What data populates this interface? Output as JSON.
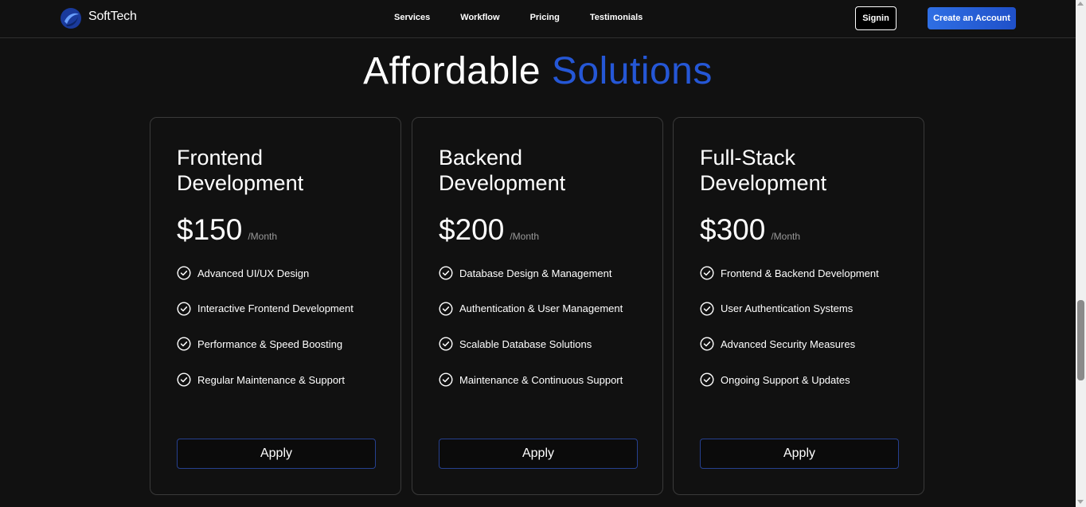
{
  "brand": {
    "name": "SoftTech",
    "accent_color": "#2557d6"
  },
  "nav": {
    "links": [
      "Services",
      "Workflow",
      "Pricing",
      "Testimonials"
    ],
    "signin_label": "Signin",
    "create_account_label": "Create an Account"
  },
  "section": {
    "title_main": "Affordable",
    "title_accent": "Solutions"
  },
  "plans": [
    {
      "title": "Frontend Development",
      "price": "$150",
      "period": "/Month",
      "features": [
        "Advanced UI/UX Design",
        "Interactive Frontend Development",
        "Performance & Speed Boosting",
        "Regular Maintenance & Support"
      ],
      "button_label": "Apply"
    },
    {
      "title": "Backend Development",
      "price": "$200",
      "period": "/Month",
      "features": [
        "Database Design & Management",
        "Authentication & User Management",
        "Scalable Database Solutions",
        "Maintenance & Continuous Support"
      ],
      "button_label": "Apply"
    },
    {
      "title": "Full-Stack Development",
      "price": "$300",
      "period": "/Month",
      "features": [
        "Frontend & Backend Development",
        "User Authentication Systems",
        "Advanced Security Measures",
        "Ongoing Support & Updates"
      ],
      "button_label": "Apply"
    }
  ]
}
